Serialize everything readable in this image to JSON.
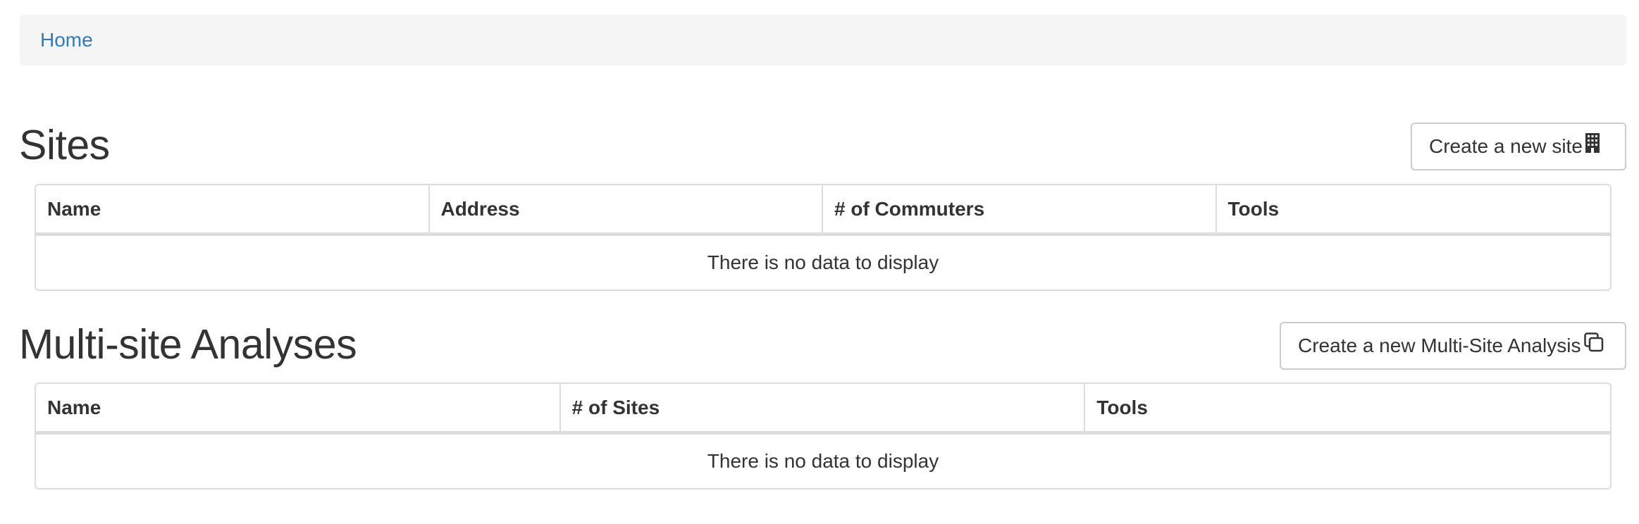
{
  "breadcrumb": {
    "home": "Home"
  },
  "sites": {
    "title": "Sites",
    "create_label": "Create a new site",
    "columns": [
      "Name",
      "Address",
      "# of Commuters",
      "Tools"
    ],
    "empty_message": "There is no data to display"
  },
  "analyses": {
    "title": "Multi-site Analyses",
    "create_label": "Create a new Multi-Site Analysis",
    "columns": [
      "Name",
      "# of Sites",
      "Tools"
    ],
    "empty_message": "There is no data to display"
  },
  "colors": {
    "link": "#337ab7",
    "breadcrumb_bg": "#f5f5f5",
    "border": "#dddddd",
    "text": "#333333"
  }
}
